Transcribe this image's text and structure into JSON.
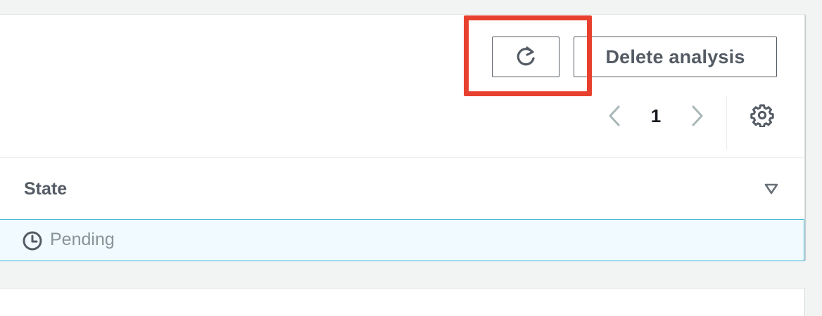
{
  "toolbar": {
    "refresh_icon": "refresh-icon",
    "delete_label": "Delete analysis"
  },
  "pagination": {
    "current_page": "1",
    "prev_icon": "chevron-left-icon",
    "next_icon": "chevron-right-icon",
    "settings_icon": "gear-icon"
  },
  "table": {
    "columns": [
      {
        "label": "State",
        "sort_icon": "sort-descending-icon"
      }
    ],
    "rows": [
      {
        "state": "Pending",
        "state_icon": "clock-icon",
        "selected": true
      }
    ]
  },
  "colors": {
    "accent_highlight": "#e8402e",
    "selected_row_bg": "#f1faff",
    "selected_row_border": "#44b9d6",
    "pending_text": "#879596"
  }
}
